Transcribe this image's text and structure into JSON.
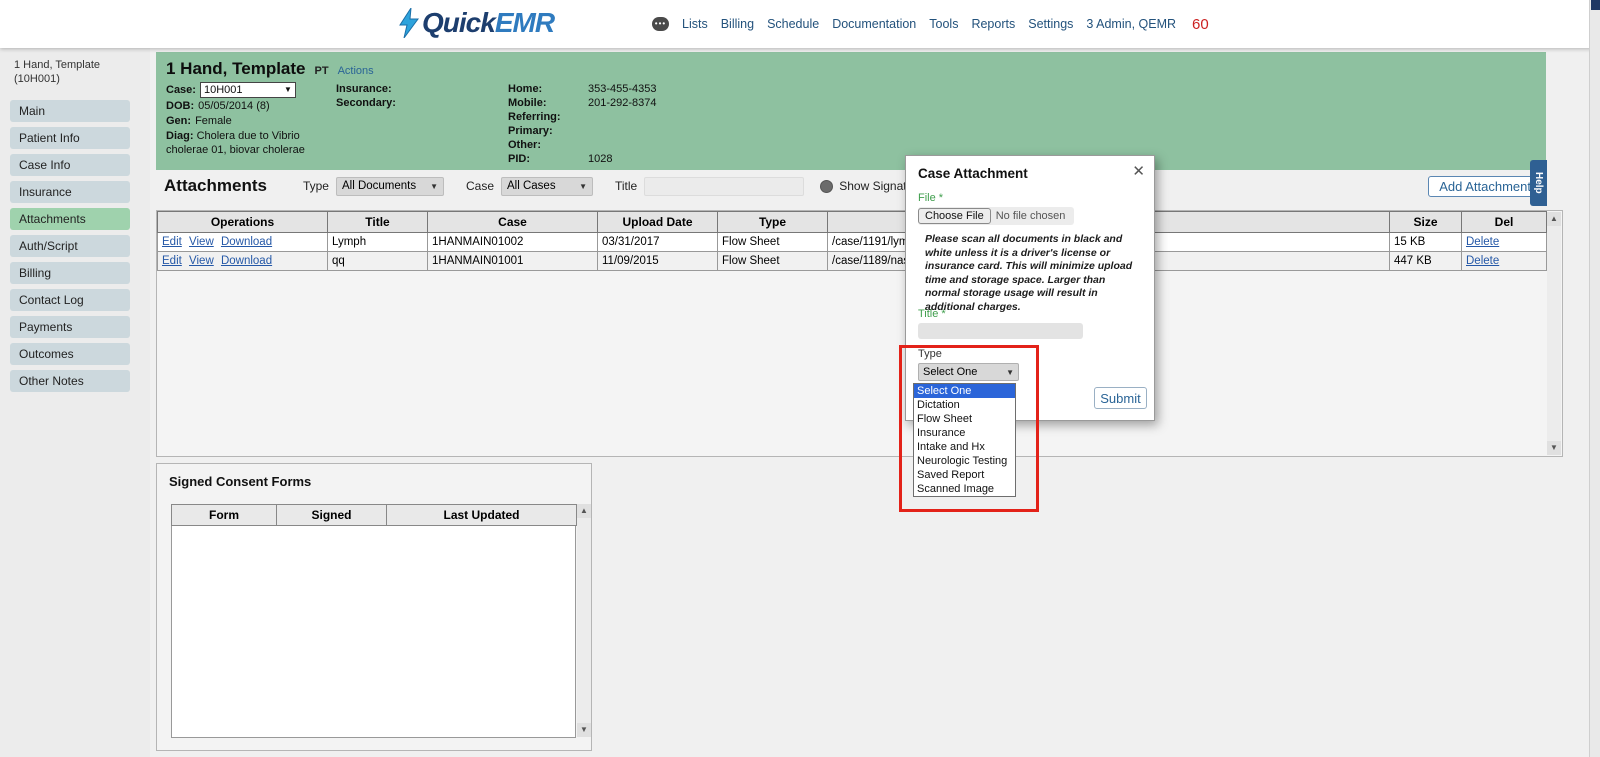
{
  "header": {
    "logo_quick": "Quick",
    "logo_emr": "EMR",
    "nav": [
      "Lists",
      "Billing",
      "Schedule",
      "Documentation",
      "Tools",
      "Reports",
      "Settings",
      "3 Admin, QEMR"
    ],
    "badge": "60",
    "chat_dots": "•••"
  },
  "sidebar": {
    "patient_name": "1 Hand, Template",
    "patient_id": "(10H001)",
    "items": [
      {
        "label": "Main"
      },
      {
        "label": "Patient Info"
      },
      {
        "label": "Case Info"
      },
      {
        "label": "Insurance"
      },
      {
        "label": "Attachments"
      },
      {
        "label": "Auth/Script"
      },
      {
        "label": "Billing"
      },
      {
        "label": "Contact Log"
      },
      {
        "label": "Payments"
      },
      {
        "label": "Outcomes"
      },
      {
        "label": "Other Notes"
      }
    ]
  },
  "patient": {
    "name": "1 Hand, Template",
    "type": "PT",
    "actions": "Actions",
    "case_label": "Case:",
    "case_value": "10H001",
    "dob_label": "DOB:",
    "dob_value": "05/05/2014 (8)",
    "gen_label": "Gen:",
    "gen_value": "Female",
    "diag_label": "Diag:",
    "diag_value": "Cholera due to Vibrio cholerae 01, biovar cholerae",
    "insurance_label": "Insurance:",
    "secondary_label": "Secondary:",
    "home_label": "Home:",
    "home_value": "353-455-4353",
    "mobile_label": "Mobile:",
    "mobile_value": "201-292-8374",
    "referring_label": "Referring:",
    "primary_label": "Primary:",
    "other_label": "Other:",
    "pid_label": "PID:",
    "pid_value": "1028"
  },
  "attachments": {
    "title": "Attachments",
    "filter_type_label": "Type",
    "filter_type_value": "All Documents",
    "filter_case_label": "Case",
    "filter_case_value": "All Cases",
    "filter_title_label": "Title",
    "show_signatures_label": "Show Signatures",
    "add_button": "Add Attachment",
    "table": {
      "headers": [
        "Operations",
        "Title",
        "Case",
        "Upload Date",
        "Type",
        "",
        "Size",
        "Del"
      ],
      "ops": {
        "edit": "Edit",
        "view": "View",
        "download": "Download",
        "delete": "Delete"
      },
      "rows": [
        {
          "title": "Lymph",
          "case": "1HANMAIN01002",
          "upload_date": "03/31/2017",
          "type": "Flow Sheet",
          "file": "/case/1191/lym",
          "size": "15 KB"
        },
        {
          "title": "qq",
          "case": "1HANMAIN01001",
          "upload_date": "11/09/2015",
          "type": "Flow Sheet",
          "file": "/case/1189/nas",
          "size": "447 KB"
        }
      ]
    }
  },
  "consent": {
    "title": "Signed Consent Forms",
    "headers": [
      "Form",
      "Signed",
      "Last Updated"
    ]
  },
  "modal": {
    "title": "Case Attachment",
    "file_label": "File *",
    "choose_file_button": "Choose File",
    "no_file_text": "No file chosen",
    "notice": "Please scan all documents in black and white unless it is a driver's license or insurance card. This will minimize upload time and storage space. Larger than normal storage usage will result in additional charges.",
    "title_label": "Title *",
    "type_label": "Type",
    "type_value": "Select One",
    "options": [
      "Select One",
      "Dictation",
      "Flow Sheet",
      "Insurance",
      "Intake and Hx",
      "Neurologic Testing",
      "Saved Report",
      "Scanned Image"
    ],
    "submit_button": "Submit"
  },
  "help_tab": "Help",
  "icons": {
    "close": "✕",
    "dropdown_arrow": "▼",
    "scroll_up": "▲",
    "scroll_down": "▼"
  },
  "colors": {
    "patient_header_bg": "#8ec1a0",
    "active_sidebar_bg": "#9fd2ad",
    "dropdown_highlight": "#2b65d9",
    "annotation_red": "#e32219",
    "link_blue": "#2558a7",
    "badge_red": "#cc2222"
  }
}
